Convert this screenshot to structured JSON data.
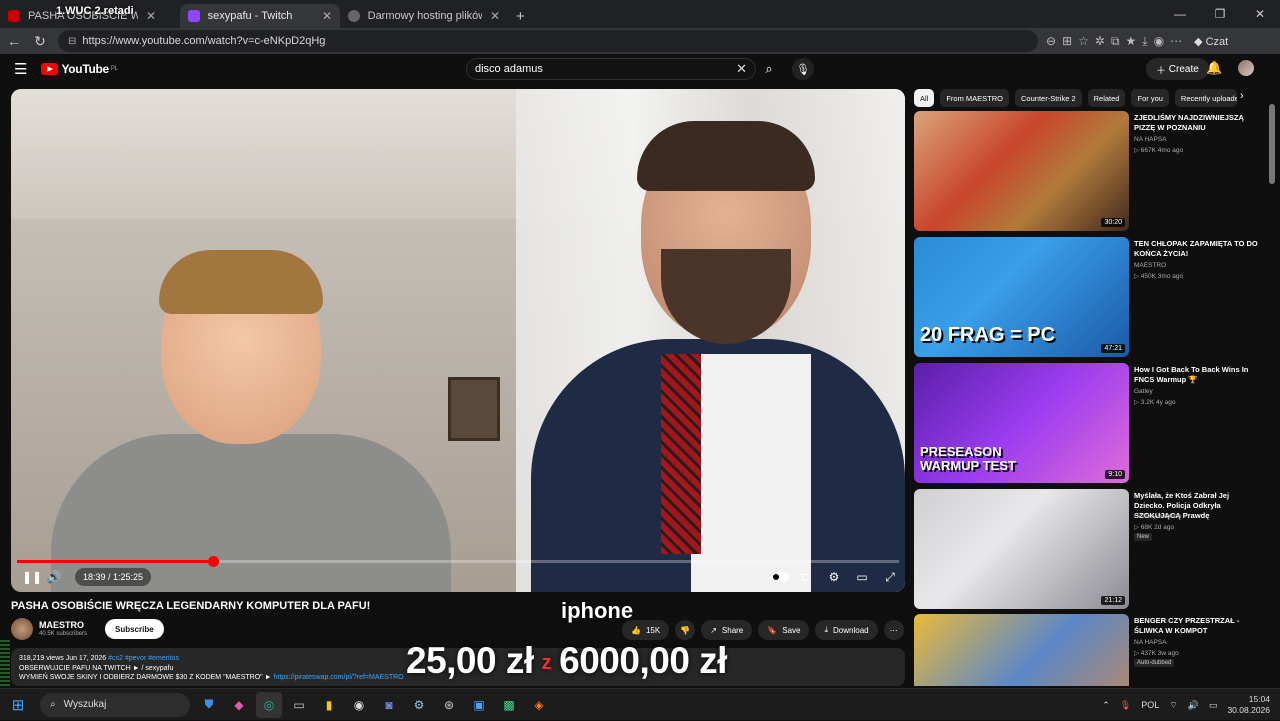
{
  "stream_overlay": {
    "text": "1.WUC  2.retadi",
    "badge": ""
  },
  "browser": {
    "tabs": [
      {
        "label": "PASHA OSOBIŚCIE WRĘCZA",
        "color": "#cc0000",
        "active": false
      },
      {
        "label": "sexypafu - Twitch",
        "color": "#9146ff",
        "active": true
      },
      {
        "label": "Darmowy hosting plików - Wrzuc",
        "color": "#777777",
        "active": false
      }
    ],
    "new_tab": "+",
    "url": "https://www.youtube.com/watch?v=c-eNKpD2qHg",
    "copilot_label": "Czat"
  },
  "youtube": {
    "logo": "YouTube",
    "logo_region": "PL",
    "search_value": "disco adamus",
    "create_label": "Create",
    "player": {
      "progress": 0.222,
      "time": "18:39 / 1:25:25"
    },
    "video_title": "PASHA OSOBIŚCIE WRĘCZA LEGENDARNY KOMPUTER DLA PAFU!",
    "channel": {
      "name": "MAESTRO",
      "subs": "40.5K subscribers"
    },
    "subscribe_label": "Subscribe",
    "actions": {
      "likes": "15K",
      "share": "Share",
      "save": "Save",
      "download": "Download"
    },
    "description": {
      "line1_prefix": "318,219 views  Jun 17, 2026",
      "tags": "#cs2 #pevor #emeritos",
      "line2": "OBSERWUJCIE PAFU NA TWITCH ► / sexypafu",
      "line3": "WYMIEŃ SWOJE SKINY I ODBIERZ DARMOWE $30 Z KODEM \"MAESTRO\" ►",
      "link": "https://pirateswap.com/pl/?ref=MAESTRO"
    },
    "overlay": {
      "iphone": "iphone",
      "price_left": "25,00 zł",
      "price_mid": "z",
      "price_right": "6000,00 zł"
    },
    "chips": [
      "All",
      "From MAESTRO",
      "Counter-Strike 2",
      "Related",
      "For you",
      "Recently uploaded"
    ],
    "recommendations": [
      {
        "title": "ZJEDLIŚMY NAJDZIWNIEJSZĄ PIZZĘ W POZNANIU",
        "channel": "NA HAPSA",
        "meta": "▷ 667K  4mo ago",
        "duration": "30:20",
        "thumb_text": ""
      },
      {
        "title": "TEN CHŁOPAK ZAPAMIĘTA TO DO KOŃCA ŻYCIA!",
        "channel": "MAESTRO",
        "meta": "▷ 450K  3mo ago",
        "duration": "47:21",
        "thumb_text": "20 FRAG = PC"
      },
      {
        "title": "How I Got Back To Back Wins In FNCS Warmup 🏆",
        "channel": "Gatley",
        "meta": "▷ 3.2K  4y ago",
        "duration": "9:10",
        "thumb_text": "PRESEASON WARMUP TEST"
      },
      {
        "title": "Myślała, że Ktoś Zabrał Jej Dziecko. Policja Odkryła SZOKUJĄCĄ Prawdę",
        "channel": "Detektywi Crime",
        "meta": "▷ 68K  2d ago",
        "duration": "21:12",
        "badge": "New",
        "thumb_text": ""
      },
      {
        "title": "BENGER CZY PRZESTRZAŁ - ŚLIWKA W KOMPOT",
        "channel": "NA HAPSA",
        "meta": "▷ 437K  3w ago",
        "duration": "",
        "badge": "Auto-dubbed",
        "thumb_text": ""
      }
    ]
  },
  "taskbar": {
    "search_placeholder": "Wyszukaj",
    "lang": "POL",
    "time": "15:04",
    "date": "30.08.2026"
  }
}
